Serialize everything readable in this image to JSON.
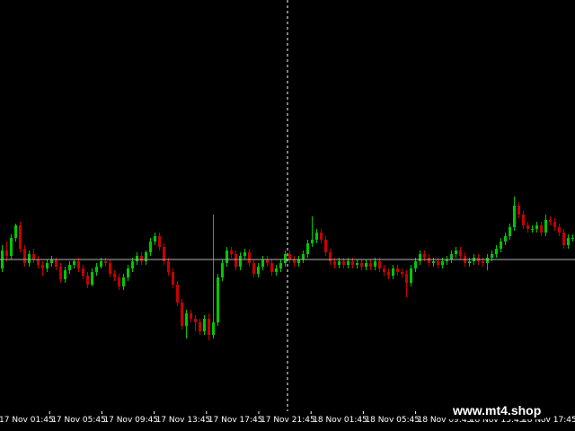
{
  "chart_data": {
    "type": "candlestick",
    "background": "#000000",
    "colors": {
      "bull": "#00c800",
      "bear": "#c80000",
      "crosshair": "#ffffff",
      "price_line": "#b4b4b4",
      "text": "#ffffff"
    },
    "grid": false,
    "x_tick_labels": [
      "17 Nov 01:45",
      "17 Nov 05:45",
      "17 Nov 09:45",
      "17 Nov 13:45",
      "17 Nov 17:45",
      "17 Nov 21:45",
      "18 Nov 01:45",
      "18 Nov 05:45",
      "18 Nov 09:45",
      "18 Nov 13:45",
      "18 Nov 17:45"
    ],
    "crosshair_at_tick": 5.55,
    "current_price": 0,
    "ylim": [
      -240,
      240
    ],
    "candles": [
      [
        -10,
        10,
        16,
        -14
      ],
      [
        10,
        4,
        20,
        -2
      ],
      [
        4,
        24,
        28,
        0
      ],
      [
        24,
        38,
        40,
        20
      ],
      [
        38,
        12,
        42,
        8
      ],
      [
        12,
        -4,
        16,
        -8
      ],
      [
        -4,
        6,
        10,
        -8
      ],
      [
        6,
        0,
        12,
        -4
      ],
      [
        0,
        -6,
        4,
        -10
      ],
      [
        -6,
        -10,
        -2,
        -18
      ],
      [
        -10,
        -4,
        0,
        -14
      ],
      [
        -4,
        0,
        4,
        -8
      ],
      [
        0,
        -8,
        2,
        -12
      ],
      [
        -8,
        -22,
        -4,
        -26
      ],
      [
        -22,
        -12,
        -8,
        -26
      ],
      [
        -12,
        -6,
        -2,
        -16
      ],
      [
        -6,
        -2,
        0,
        -10
      ],
      [
        -2,
        -10,
        2,
        -14
      ],
      [
        -10,
        -18,
        -6,
        -22
      ],
      [
        -18,
        -28,
        -14,
        -32
      ],
      [
        -28,
        -14,
        -10,
        -30
      ],
      [
        -14,
        -8,
        -4,
        -18
      ],
      [
        -8,
        -2,
        2,
        -10
      ],
      [
        -2,
        -4,
        2,
        -8
      ],
      [
        -4,
        -16,
        0,
        -20
      ],
      [
        -16,
        -20,
        -12,
        -24
      ],
      [
        -20,
        -30,
        -16,
        -34
      ],
      [
        -30,
        -20,
        -16,
        -34
      ],
      [
        -20,
        -10,
        -6,
        -24
      ],
      [
        -10,
        -2,
        2,
        -14
      ],
      [
        -2,
        4,
        8,
        -6
      ],
      [
        4,
        -2,
        8,
        -6
      ],
      [
        -2,
        8,
        10,
        -6
      ],
      [
        8,
        20,
        24,
        4
      ],
      [
        20,
        26,
        30,
        16
      ],
      [
        26,
        14,
        30,
        10
      ],
      [
        14,
        -2,
        18,
        -6
      ],
      [
        -2,
        -14,
        2,
        -18
      ],
      [
        -14,
        -28,
        -10,
        -32
      ],
      [
        -28,
        -48,
        -24,
        -52
      ],
      [
        -48,
        -74,
        -44,
        -78
      ],
      [
        -74,
        -60,
        -56,
        -88
      ],
      [
        -60,
        -66,
        -56,
        -70
      ],
      [
        -66,
        -70,
        -62,
        -80
      ],
      [
        -70,
        -80,
        -66,
        -84
      ],
      [
        -80,
        -66,
        -62,
        -84
      ],
      [
        -66,
        -84,
        -60,
        -90
      ],
      [
        -84,
        -70,
        50,
        -88
      ],
      [
        -70,
        -20,
        -16,
        -74
      ],
      [
        -20,
        -4,
        0,
        -24
      ],
      [
        -4,
        10,
        14,
        -8
      ],
      [
        10,
        6,
        14,
        2
      ],
      [
        6,
        -8,
        10,
        -12
      ],
      [
        -8,
        4,
        8,
        -12
      ],
      [
        4,
        8,
        12,
        0
      ],
      [
        8,
        -4,
        12,
        -8
      ],
      [
        -4,
        -16,
        0,
        -20
      ],
      [
        -16,
        -8,
        -4,
        -20
      ],
      [
        -8,
        0,
        4,
        -12
      ],
      [
        0,
        -4,
        4,
        -8
      ],
      [
        -4,
        -14,
        0,
        -18
      ],
      [
        -14,
        -10,
        -6,
        -18
      ],
      [
        -10,
        -4,
        0,
        -14
      ],
      [
        -4,
        6,
        10,
        -8
      ],
      [
        6,
        0,
        10,
        -4
      ],
      [
        0,
        -4,
        4,
        -8
      ],
      [
        -4,
        0,
        4,
        -8
      ],
      [
        0,
        6,
        10,
        -4
      ],
      [
        6,
        18,
        22,
        2
      ],
      [
        18,
        22,
        48,
        14
      ],
      [
        22,
        30,
        34,
        18
      ],
      [
        30,
        22,
        34,
        18
      ],
      [
        22,
        8,
        26,
        4
      ],
      [
        8,
        -2,
        12,
        -6
      ],
      [
        -2,
        -6,
        2,
        -10
      ],
      [
        -6,
        -2,
        2,
        -10
      ],
      [
        -2,
        -6,
        2,
        -10
      ],
      [
        -6,
        -2,
        2,
        -10
      ],
      [
        -2,
        -6,
        2,
        -10
      ],
      [
        -6,
        -4,
        0,
        -10
      ],
      [
        -4,
        -8,
        0,
        -12
      ],
      [
        -8,
        -4,
        0,
        -12
      ],
      [
        -4,
        -8,
        0,
        -12
      ],
      [
        -8,
        -2,
        2,
        -12
      ],
      [
        -2,
        -10,
        2,
        -14
      ],
      [
        -10,
        -14,
        -6,
        -18
      ],
      [
        -14,
        -18,
        -10,
        -22
      ],
      [
        -18,
        -10,
        -6,
        -22
      ],
      [
        -10,
        -14,
        -6,
        -18
      ],
      [
        -14,
        -16,
        -10,
        -20
      ],
      [
        -16,
        -26,
        -12,
        -42
      ],
      [
        -26,
        -10,
        -6,
        -30
      ],
      [
        -10,
        -2,
        2,
        -14
      ],
      [
        -2,
        6,
        10,
        -6
      ],
      [
        6,
        2,
        10,
        -2
      ],
      [
        2,
        -4,
        6,
        -8
      ],
      [
        -4,
        -2,
        2,
        -8
      ],
      [
        -2,
        -6,
        2,
        -10
      ],
      [
        -6,
        -2,
        2,
        -10
      ],
      [
        -2,
        0,
        4,
        -6
      ],
      [
        0,
        6,
        10,
        -4
      ],
      [
        6,
        10,
        14,
        2
      ],
      [
        10,
        4,
        14,
        0
      ],
      [
        4,
        -4,
        8,
        -8
      ],
      [
        -4,
        -2,
        2,
        -8
      ],
      [
        -2,
        2,
        6,
        -6
      ],
      [
        2,
        -2,
        6,
        -6
      ],
      [
        -2,
        -4,
        2,
        -8
      ],
      [
        -4,
        2,
        6,
        -12
      ],
      [
        2,
        6,
        10,
        -2
      ],
      [
        6,
        12,
        16,
        2
      ],
      [
        12,
        20,
        24,
        8
      ],
      [
        20,
        26,
        30,
        16
      ],
      [
        26,
        36,
        40,
        22
      ],
      [
        36,
        60,
        70,
        32
      ],
      [
        60,
        50,
        64,
        46
      ],
      [
        50,
        38,
        54,
        34
      ],
      [
        38,
        34,
        42,
        30
      ],
      [
        34,
        34,
        38,
        30
      ],
      [
        34,
        38,
        42,
        30
      ],
      [
        38,
        30,
        42,
        26
      ],
      [
        30,
        44,
        50,
        26
      ],
      [
        44,
        42,
        48,
        38
      ],
      [
        42,
        36,
        46,
        32
      ],
      [
        36,
        30,
        40,
        26
      ],
      [
        30,
        16,
        34,
        12
      ],
      [
        16,
        24,
        28,
        12
      ],
      [
        24,
        24,
        28,
        20
      ]
    ]
  },
  "watermark": "www.mt4.shop"
}
